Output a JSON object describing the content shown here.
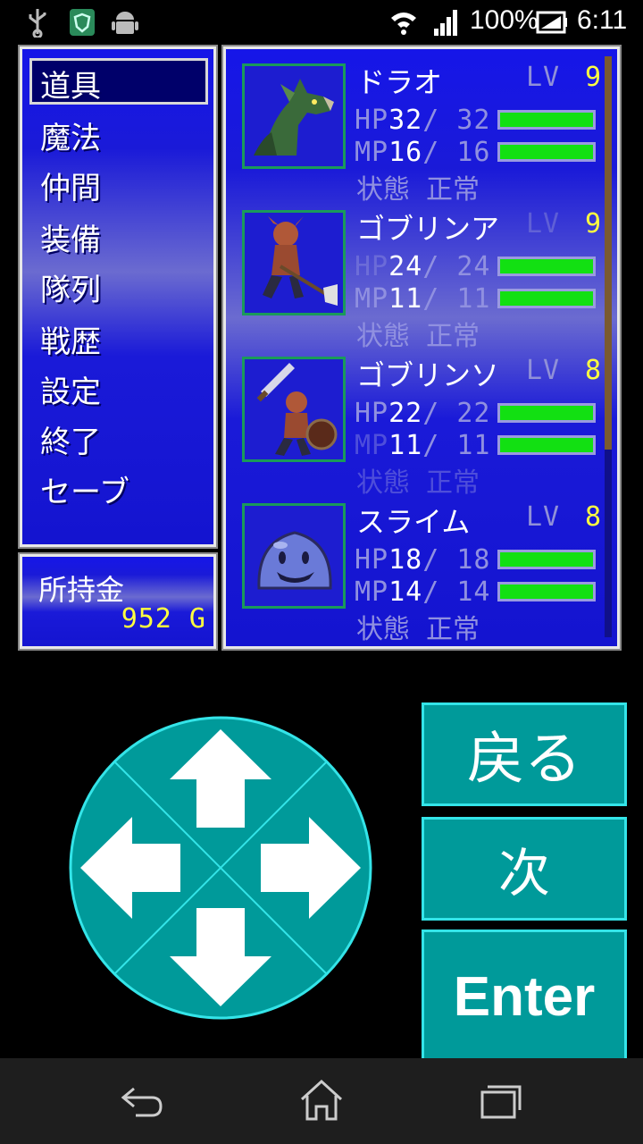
{
  "status_bar": {
    "battery": "100%",
    "time": "6:11",
    "icons": [
      "usb-icon",
      "shield-app-icon",
      "android-icon",
      "wifi-icon",
      "signal-icon",
      "battery-charging-icon"
    ]
  },
  "menu": {
    "items": [
      "道具",
      "魔法",
      "仲間",
      "装備",
      "隊列",
      "戦歴",
      "設定",
      "終了",
      "セーブ"
    ],
    "selected": "道具"
  },
  "gold": {
    "label": "所持金",
    "value": "952 G"
  },
  "party": [
    {
      "name": "ドラオ",
      "lv_label": "LV",
      "lv": "9",
      "hp_label": "HP",
      "hp": "32",
      "hp_max": "32",
      "mp_label": "MP",
      "mp": "16",
      "mp_max": "16",
      "state_label": "状態",
      "state": "正常",
      "hp_fill": 1.0,
      "mp_fill": 1.0,
      "portrait_icon": "dragon-portrait-icon"
    },
    {
      "name": "ゴブリンア",
      "lv_label": "LV",
      "lv": "9",
      "hp_label": "HP",
      "hp": "24",
      "hp_max": "24",
      "mp_label": "MP",
      "mp": "11",
      "mp_max": "11",
      "state_label": "状態",
      "state": "正常",
      "hp_fill": 1.0,
      "mp_fill": 1.0,
      "portrait_icon": "goblin-axe-portrait-icon"
    },
    {
      "name": "ゴブリンソ",
      "lv_label": "LV",
      "lv": "8",
      "hp_label": "HP",
      "hp": "22",
      "hp_max": "22",
      "mp_label": "MP",
      "mp": "11",
      "mp_max": "11",
      "state_label": "状態",
      "state": "正常",
      "hp_fill": 1.0,
      "mp_fill": 1.0,
      "portrait_icon": "goblin-sword-portrait-icon"
    },
    {
      "name": "スライム",
      "lv_label": "LV",
      "lv": "8",
      "hp_label": "HP",
      "hp": "18",
      "hp_max": "18",
      "mp_label": "MP",
      "mp": "14",
      "mp_max": "14",
      "state_label": "状態",
      "state": "正常",
      "hp_fill": 1.0,
      "mp_fill": 1.0,
      "portrait_icon": "slime-portrait-icon"
    }
  ],
  "controls": {
    "back_label": "戻る",
    "next_label": "次",
    "enter_label": "Enter",
    "dpad_icons": [
      "up-arrow-icon",
      "down-arrow-icon",
      "left-arrow-icon",
      "right-arrow-icon"
    ]
  },
  "nav_bar": {
    "icons": [
      "back-icon",
      "home-icon",
      "recents-icon"
    ]
  },
  "colors": {
    "panel_blue": "#1a1ad8",
    "control_teal": "#009a9a",
    "control_border": "#34e4e8",
    "hp_bar": "#12e012",
    "gold_text": "#ffff40"
  }
}
